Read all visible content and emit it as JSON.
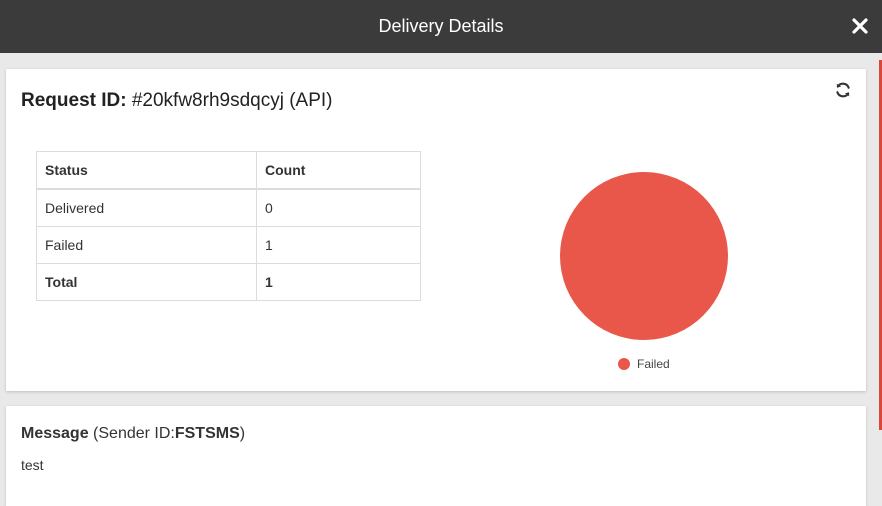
{
  "header": {
    "title": "Delivery Details",
    "close_icon": "close-icon"
  },
  "request": {
    "label": "Request ID:",
    "id": "#20kfw8rh9sdqcyj",
    "source": "(API)",
    "refresh_icon": "refresh-icon"
  },
  "table": {
    "headers": [
      "Status",
      "Count"
    ],
    "rows": [
      {
        "status": "Delivered",
        "count": "0"
      },
      {
        "status": "Failed",
        "count": "1"
      },
      {
        "status": "Total",
        "count": "1"
      }
    ]
  },
  "chart_data": {
    "type": "pie",
    "categories": [
      "Delivered",
      "Failed"
    ],
    "values": [
      0,
      1
    ],
    "legend": [
      "Failed"
    ],
    "legend_placement": "bottom",
    "colors": {
      "Failed": "#e8574a"
    }
  },
  "message": {
    "label": "Message",
    "sender_prefix": "(Sender ID:",
    "sender_id": "FSTSMS",
    "sender_suffix": ")",
    "body": "test"
  },
  "colors": {
    "header_bg": "#3b3b3b",
    "failed": "#e8574a",
    "accent_strip": "#d9463a"
  }
}
